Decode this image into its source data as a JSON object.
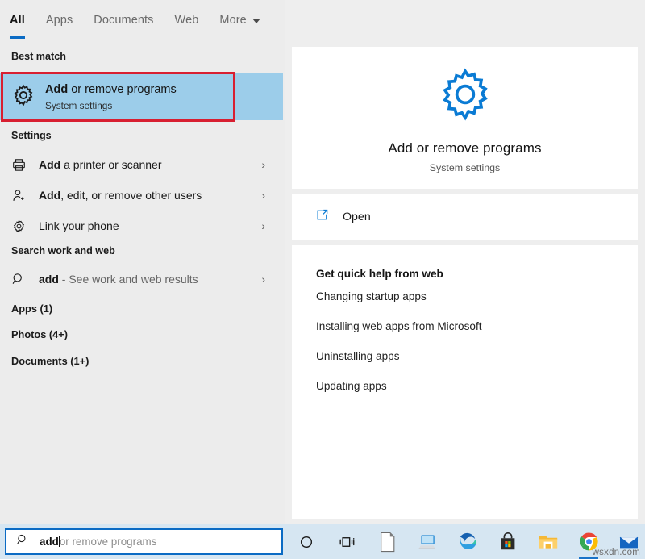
{
  "header": {
    "tabs": [
      {
        "label": "All",
        "active": true
      },
      {
        "label": "Apps",
        "active": false
      },
      {
        "label": "Documents",
        "active": false
      },
      {
        "label": "Web",
        "active": false
      },
      {
        "label": "More",
        "active": false,
        "has_caret": true
      }
    ],
    "feedback_icon": "person-feedback-icon",
    "overflow_label": "···"
  },
  "left": {
    "best_match_heading": "Best match",
    "best_match": {
      "title_bold": "Add",
      "title_rest": " or remove programs",
      "subtitle": "System settings",
      "icon": "gear-icon",
      "selected": true,
      "highlight_color": "#9ccdea",
      "annotation_color": "#d81f31"
    },
    "settings_heading": "Settings",
    "settings_items": [
      {
        "bold": "Add",
        "rest": " a printer or scanner",
        "icon": "printer-icon",
        "chevron": "›"
      },
      {
        "bold": "Add",
        "rest": ", edit, or remove other users",
        "icon": "add-user-icon",
        "chevron": "›"
      },
      {
        "bold": "",
        "rest": "Link your phone",
        "icon": "gear-small-icon",
        "chevron": "›"
      }
    ],
    "web_heading": "Search work and web",
    "web_item": {
      "query": "add",
      "suffix": " - See work and web results",
      "icon": "search-icon",
      "chevron": "›"
    },
    "counts": [
      {
        "label": "Apps (1)"
      },
      {
        "label": "Photos (4+)"
      },
      {
        "label": "Documents (1+)"
      }
    ]
  },
  "right": {
    "preview": {
      "icon": "gear-icon-large",
      "icon_color": "#0a7bd4",
      "title": "Add or remove programs",
      "subtitle": "System settings"
    },
    "open_action": {
      "label": "Open",
      "icon": "open-external-icon",
      "icon_color": "#0a7bd4"
    },
    "help_title": "Get quick help from web",
    "help_links": [
      "Changing startup apps",
      "Installing web apps from Microsoft",
      "Uninstalling apps",
      "Updating apps"
    ]
  },
  "taskbar": {
    "search": {
      "icon": "search-icon",
      "typed_text": "add",
      "suggestion_text": "or remove programs",
      "border_color": "#0b6bc4"
    },
    "items": [
      {
        "name": "cortana-icon",
        "running": false
      },
      {
        "name": "task-view-icon",
        "running": false
      },
      {
        "name": "document-icon",
        "running": false
      },
      {
        "name": "remote-desktop-icon",
        "running": false
      },
      {
        "name": "edge-icon",
        "running": false
      },
      {
        "name": "microsoft-store-icon",
        "running": false
      },
      {
        "name": "file-explorer-icon",
        "running": false
      },
      {
        "name": "chrome-icon",
        "running": true
      },
      {
        "name": "mail-icon",
        "running": false
      }
    ]
  },
  "watermark": "wsxdn.com"
}
